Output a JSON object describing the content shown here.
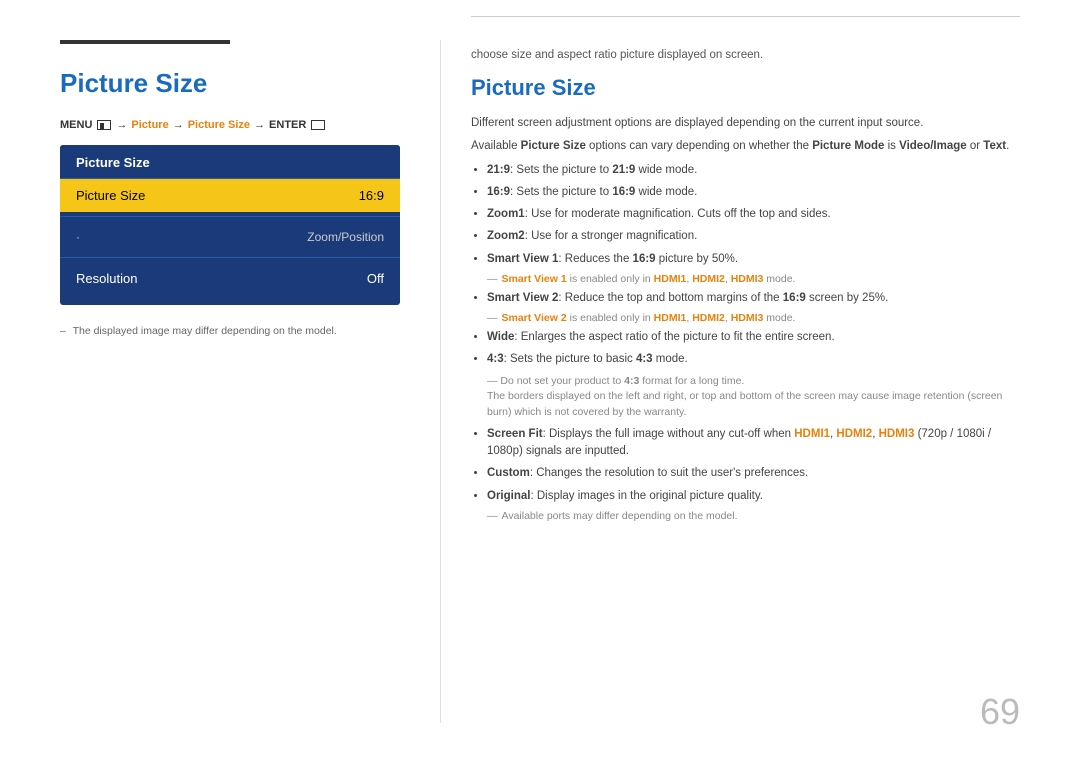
{
  "left": {
    "title": "Picture Size",
    "menu_path": {
      "menu_label": "MENU",
      "arrow1": "→",
      "picture": "Picture",
      "arrow2": "→",
      "picture_size": "Picture Size",
      "arrow3": "→",
      "enter": "ENTER"
    },
    "menu_box": {
      "title": "Picture Size",
      "items": [
        {
          "label": "Picture Size",
          "value": "16:9",
          "selected": true
        },
        {
          "label": "Zoom/Position",
          "value": "",
          "bullet": true
        },
        {
          "label": "Resolution",
          "value": "Off"
        }
      ]
    },
    "note": "The displayed image may differ depending on the model."
  },
  "right": {
    "intro": "choose size and aspect ratio picture displayed on screen.",
    "title": "Picture Size",
    "desc1": "Different screen adjustment options are displayed depending on the current input source.",
    "desc2_pre": "Available ",
    "desc2_bold": "Picture Size",
    "desc2_mid": " options can vary depending on whether the ",
    "desc2_bold2": "Picture Mode",
    "desc2_mid2": " is ",
    "desc2_bold3": "Video/Image",
    "desc2_mid3": " or ",
    "desc2_bold4": "Text",
    "desc2_end": ".",
    "bullets": [
      {
        "bold": "21:9",
        "text": ": Sets the picture to ",
        "bold2": "21:9",
        "text2": " wide mode."
      },
      {
        "bold": "16:9",
        "text": ": Sets the picture to ",
        "bold2": "16:9",
        "text2": " wide mode."
      },
      {
        "bold": "Zoom1",
        "text": ": Use for moderate magnification. Cuts off the top and sides."
      },
      {
        "bold": "Zoom2",
        "text": ": Use for a stronger magnification."
      },
      {
        "bold": "Smart View 1",
        "text": ": Reduces the ",
        "bold2": "16:9",
        "text2": " picture by 50%.",
        "subnote": {
          "dash": "—",
          "bold": "Smart View 1",
          "text": " is enabled only in ",
          "bold2": "HDMI1",
          "sep1": ", ",
          "bold3": "HDMI2",
          "sep2": ", ",
          "bold4": "HDMI3",
          "text2": " mode."
        }
      },
      {
        "bold": "Smart View 2",
        "text": ": Reduce the top and bottom margins of the ",
        "bold2": "16:9",
        "text2": " screen by 25%.",
        "subnote": {
          "dash": "—",
          "bold": "Smart View 2",
          "text": " is enabled only in ",
          "bold2": "HDMI1",
          "sep1": ", ",
          "bold3": "HDMI2",
          "sep2": ", ",
          "bold4": "HDMI3",
          "text2": " mode."
        }
      },
      {
        "bold": "Wide",
        "text": ": Enlarges the aspect ratio of the picture to fit the entire screen."
      },
      {
        "bold": "4:3",
        "text": ": Sets the picture to basic ",
        "bold2": "4:3",
        "text2": " mode.",
        "warning": {
          "line1": "— Do not set your product to 4:3 format for a long time.",
          "line2": "The borders displayed on the left and right, or top and bottom of the screen may cause image retention (screen burn) which is not covered by the warranty."
        }
      },
      {
        "bold": "Screen Fit",
        "text": ": Displays the full image without any cut-off when ",
        "bold2": "HDMI1",
        "sep1": ", ",
        "bold3": "HDMI2",
        "sep2": ", ",
        "bold4": "HDMI3",
        "text2": " (720p / 1080i / 1080p) signals are inputted."
      },
      {
        "bold": "Custom",
        "text": ": Changes the resolution to suit the user's preferences."
      },
      {
        "bold": "Original",
        "text": ": Display images in the original picture quality.",
        "subnote2": "— Available ports may differ depending on the model."
      }
    ]
  },
  "page_number": "69"
}
